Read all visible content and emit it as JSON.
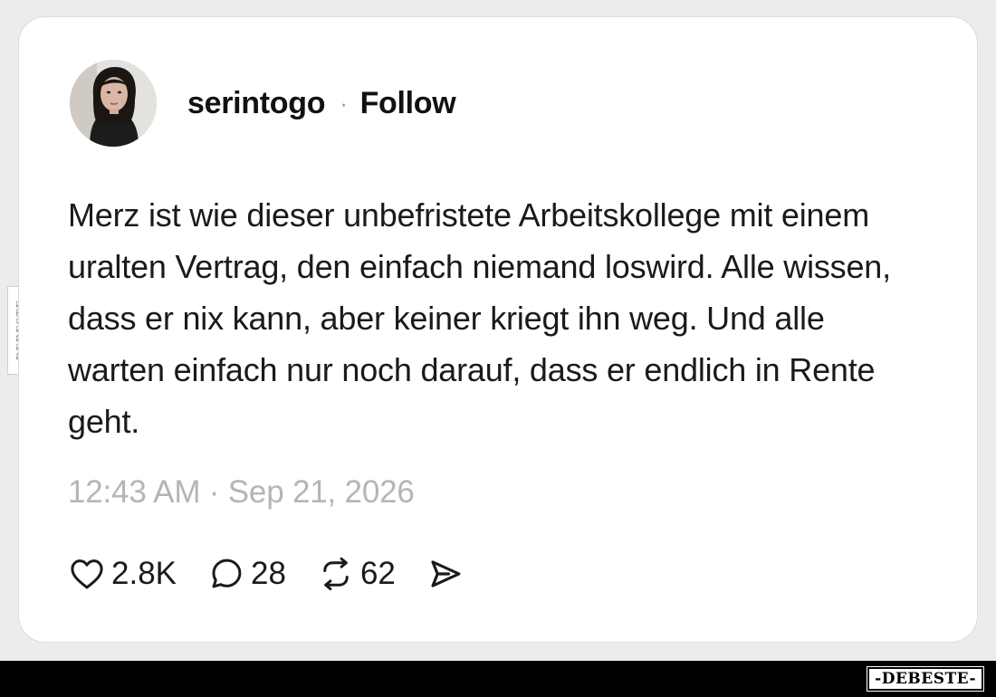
{
  "post": {
    "username": "serintogo",
    "separator": "·",
    "follow_label": "Follow",
    "text": "Merz ist wie dieser unbefristete Arbeitskollege mit einem uralten Vertrag, den einfach niemand loswird. Alle wissen, dass er nix kann, aber keiner kriegt ihn weg. Und alle warten einfach nur noch darauf, dass er endlich in Rente geht.",
    "timestamp": "12:43 AM · Sep 21, 2026"
  },
  "actions": {
    "likes": "2.8K",
    "comments": "28",
    "reposts": "62",
    "like_icon": "heart-icon",
    "comment_icon": "comment-bubble-icon",
    "repost_icon": "repost-icon",
    "share_icon": "send-icon"
  },
  "watermark": {
    "side_text": "DEBESTE",
    "footer_text": "-DEBESTE-"
  },
  "colors": {
    "background": "#ececec",
    "card": "#ffffff",
    "text": "#1a1a1a",
    "muted": "#b5b5b5",
    "footer": "#000000"
  }
}
